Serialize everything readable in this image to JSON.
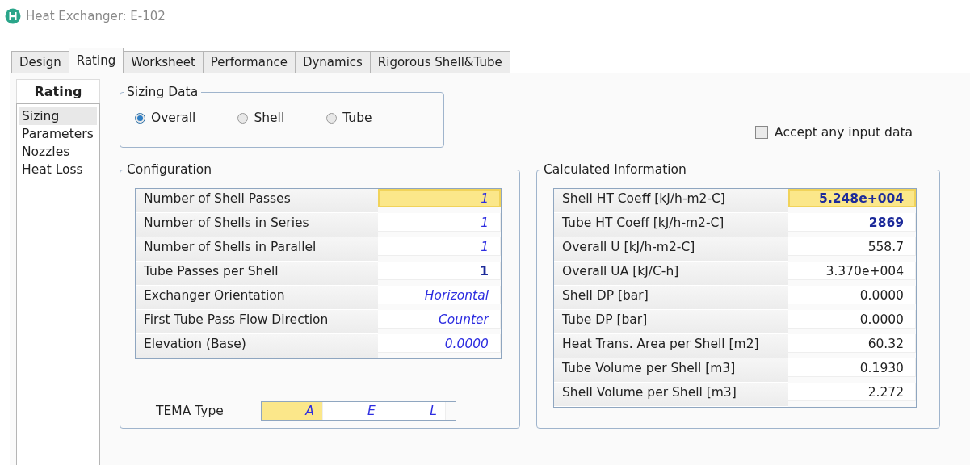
{
  "window": {
    "title": "Heat Exchanger: E-102"
  },
  "tabs": [
    {
      "label": "Design",
      "selected": false
    },
    {
      "label": "Rating",
      "selected": true
    },
    {
      "label": "Worksheet",
      "selected": false
    },
    {
      "label": "Performance",
      "selected": false
    },
    {
      "label": "Dynamics",
      "selected": false
    },
    {
      "label": "Rigorous Shell&Tube",
      "selected": false
    }
  ],
  "sidebar": {
    "title": "Rating",
    "items": [
      {
        "label": "Sizing",
        "selected": true
      },
      {
        "label": "Parameters",
        "selected": false
      },
      {
        "label": "Nozzles",
        "selected": false
      },
      {
        "label": "Heat Loss",
        "selected": false
      }
    ]
  },
  "sizing_data": {
    "title": "Sizing Data",
    "options": [
      {
        "label": "Overall",
        "selected": true
      },
      {
        "label": "Shell",
        "selected": false
      },
      {
        "label": "Tube",
        "selected": false
      }
    ]
  },
  "accept_any_input": {
    "label": "Accept any input data",
    "checked": false
  },
  "configuration": {
    "title": "Configuration",
    "rows": [
      {
        "label": "Number of Shell Passes",
        "value": "1",
        "kind": "input",
        "selected": true
      },
      {
        "label": "Number of Shells in Series",
        "value": "1",
        "kind": "input",
        "selected": false
      },
      {
        "label": "Number of Shells in Parallel",
        "value": "1",
        "kind": "input",
        "selected": false
      },
      {
        "label": "Tube Passes per Shell",
        "value": "1",
        "kind": "calc",
        "selected": false
      },
      {
        "label": "Exchanger Orientation",
        "value": "Horizontal",
        "kind": "input",
        "selected": false
      },
      {
        "label": "First Tube Pass Flow Direction",
        "value": "Counter",
        "kind": "input",
        "selected": false
      },
      {
        "label": "Elevation (Base)",
        "value": "0.0000",
        "kind": "input",
        "selected": false
      }
    ],
    "tema": {
      "label": "TEMA Type",
      "cells": [
        {
          "value": "A",
          "selected": true
        },
        {
          "value": "E",
          "selected": false
        },
        {
          "value": "L",
          "selected": false
        }
      ]
    }
  },
  "calculated_information": {
    "title": "Calculated Information",
    "rows": [
      {
        "label": "Shell HT Coeff [kJ/h-m2-C]",
        "value": "5.248e+004",
        "kind": "calc",
        "selected": true
      },
      {
        "label": "Tube HT Coeff [kJ/h-m2-C]",
        "value": "2869",
        "kind": "calc",
        "selected": false
      },
      {
        "label": "Overall U [kJ/h-m2-C]",
        "value": "558.7",
        "kind": "fixed",
        "selected": false
      },
      {
        "label": "Overall UA [kJ/C-h]",
        "value": "3.370e+004",
        "kind": "fixed",
        "selected": false
      },
      {
        "label": "Shell DP [bar]",
        "value": "0.0000",
        "kind": "fixed",
        "selected": false
      },
      {
        "label": "Tube DP [bar]",
        "value": "0.0000",
        "kind": "fixed",
        "selected": false
      },
      {
        "label": "Heat Trans. Area per Shell [m2]",
        "value": "60.32",
        "kind": "fixed",
        "selected": false
      },
      {
        "label": "Tube Volume per Shell [m3]",
        "value": "0.1930",
        "kind": "fixed",
        "selected": false
      },
      {
        "label": "Shell Volume per Shell [m3]",
        "value": "2.272",
        "kind": "fixed",
        "selected": false
      }
    ]
  }
}
